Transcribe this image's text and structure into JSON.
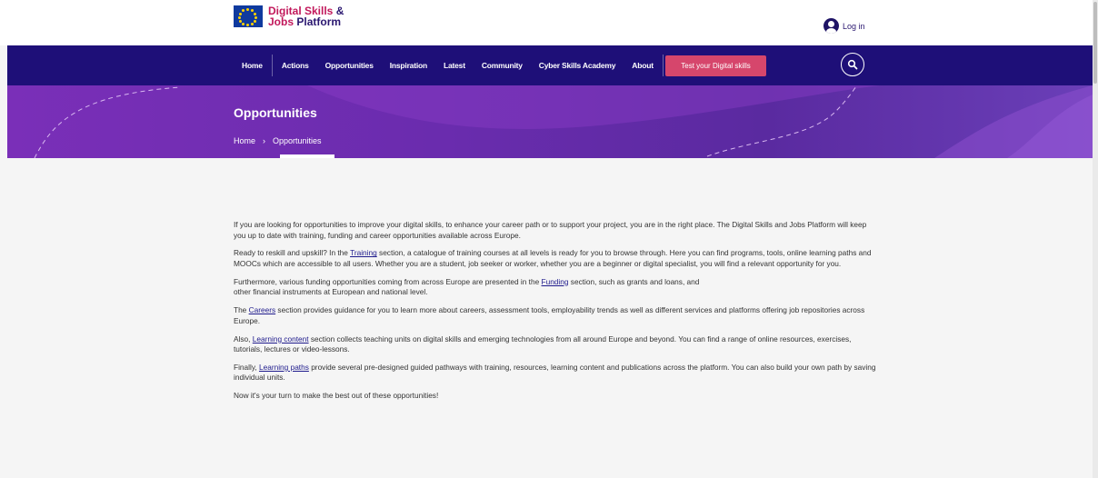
{
  "header": {
    "brand_line1": "Digital Skills",
    "brand_amp": "&",
    "brand_line2": "Jobs",
    "brand_line2b": "Platform",
    "login_label": "Log in"
  },
  "nav": {
    "items": [
      "Home",
      "Actions",
      "Opportunities",
      "Inspiration",
      "Latest",
      "Community",
      "Cyber Skills Academy",
      "About"
    ],
    "cta_label": "Test your Digital skills"
  },
  "hero": {
    "title": "Opportunities",
    "breadcrumb_home": "Home",
    "breadcrumb_sep": "›",
    "breadcrumb_current": "Opportunities"
  },
  "content": {
    "p1": "If you are looking for opportunities to improve your digital skills, to enhance your career path or to support your project, you are in the right place. The Digital Skills and Jobs Platform will keep you up to date with training, funding and career opportunities available across Europe.",
    "p2_a": "Ready to reskill and upskill? In the ",
    "p2_link": "Training",
    "p2_b": " section, a catalogue of training courses at all levels is ready for you to browse through. Here you can find programs, tools, online learning paths and MOOCs which are accessible to all users. Whether you are a student, job seeker or worker, whether you are a beginner or digital specialist, you will find a relevant opportunity for you.",
    "p3_a": "Furthermore, various funding opportunities coming from across Europe are presented in the ",
    "p3_link": "Funding",
    "p3_b": " section, such as grants and loans, and",
    "p3_c": "other financial instruments at European and national level.",
    "p4_a": "The ",
    "p4_link": "Careers",
    "p4_b": " section provides guidance for you to learn more about careers, assessment tools, employability trends as well as different services and platforms offering job repositories across Europe.",
    "p5_a": "Also, ",
    "p5_link": "Learning content",
    "p5_b": " section collects teaching units on digital skills and emerging technologies from all around Europe and beyond. You can find a range of online resources, exercises, tutorials, lectures or video-lessons.",
    "p6_a": "Finally, ",
    "p6_link": "Learning paths",
    "p6_b": " provide several pre-designed guided pathways with training, resources, learning content and publications across the platform. You can also build your own path by saving individual units.",
    "p7": "Now it's your turn to make the best out of these opportunities!"
  },
  "icons": {
    "flag": "eu-flag-icon",
    "user": "user-icon",
    "search": "search-icon"
  },
  "colors": {
    "nav_bg": "#1e0f78",
    "cta_bg": "#d6466c",
    "brand_pink": "#c2185b",
    "hero_purple": "#6a2cae"
  }
}
